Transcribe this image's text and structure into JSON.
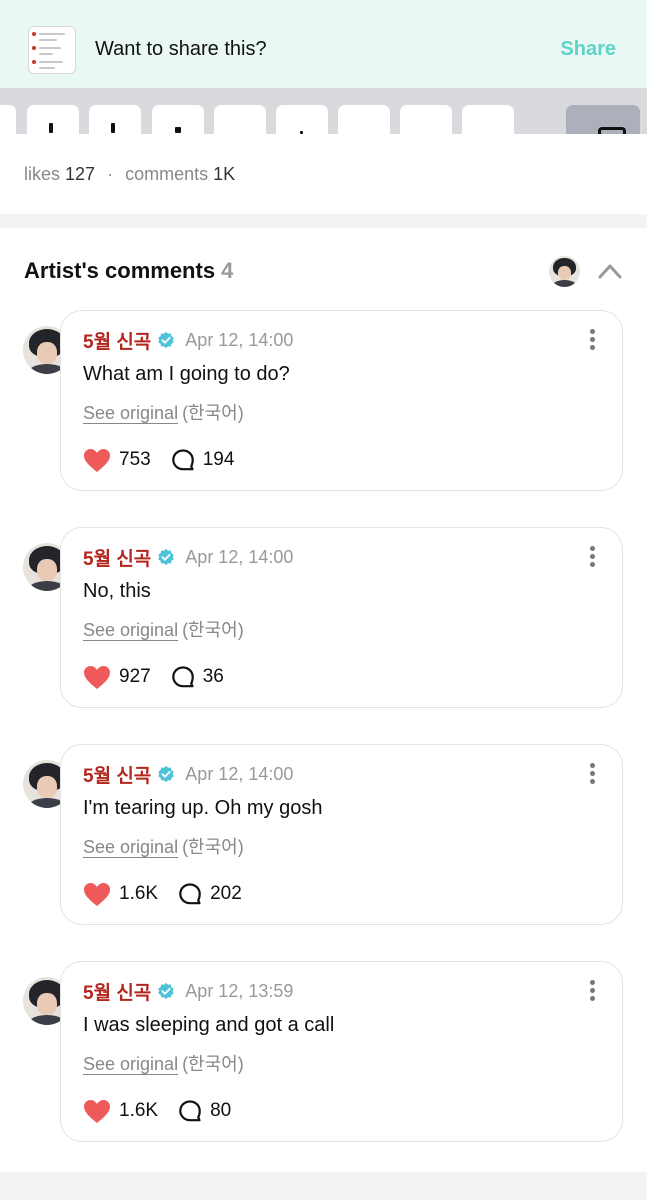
{
  "share_banner": {
    "text": "Want to share this?",
    "button": "Share"
  },
  "stats": {
    "likes_label": "likes",
    "likes_value": "127",
    "separator": "·",
    "comments_label": "comments",
    "comments_value": "1K"
  },
  "artist_comments": {
    "title": "Artist's comments",
    "count": "4"
  },
  "comments": [
    {
      "author": "5월 신곡",
      "time": "Apr 12, 14:00",
      "text": "What am I going to do?",
      "see_original": "See original",
      "language": "(한국어)",
      "likes": "753",
      "replies": "194"
    },
    {
      "author": "5월 신곡",
      "time": "Apr 12, 14:00",
      "text": "No, this",
      "see_original": "See original",
      "language": "(한국어)",
      "likes": "927",
      "replies": "36"
    },
    {
      "author": "5월 신곡",
      "time": "Apr 12, 14:00",
      "text": "I'm tearing up. Oh my gosh",
      "see_original": "See original",
      "language": "(한국어)",
      "likes": "1.6K",
      "replies": "202"
    },
    {
      "author": "5월 신곡",
      "time": "Apr 12, 13:59",
      "text": "I was sleeping and got a call",
      "see_original": "See original",
      "language": "(한국어)",
      "likes": "1.6K",
      "replies": "80"
    }
  ],
  "colors": {
    "accent": "#5fd3c8",
    "author": "#b3261e",
    "heart": "#ee5a5a",
    "banner_bg": "#e9f8f5",
    "verified": "#4fc3d6"
  },
  "icons": {
    "verified": "verified-badge-icon",
    "like": "heart-icon",
    "reply": "speech-bubble-icon",
    "more": "kebab-menu-icon",
    "collapse": "chevron-up-icon"
  }
}
